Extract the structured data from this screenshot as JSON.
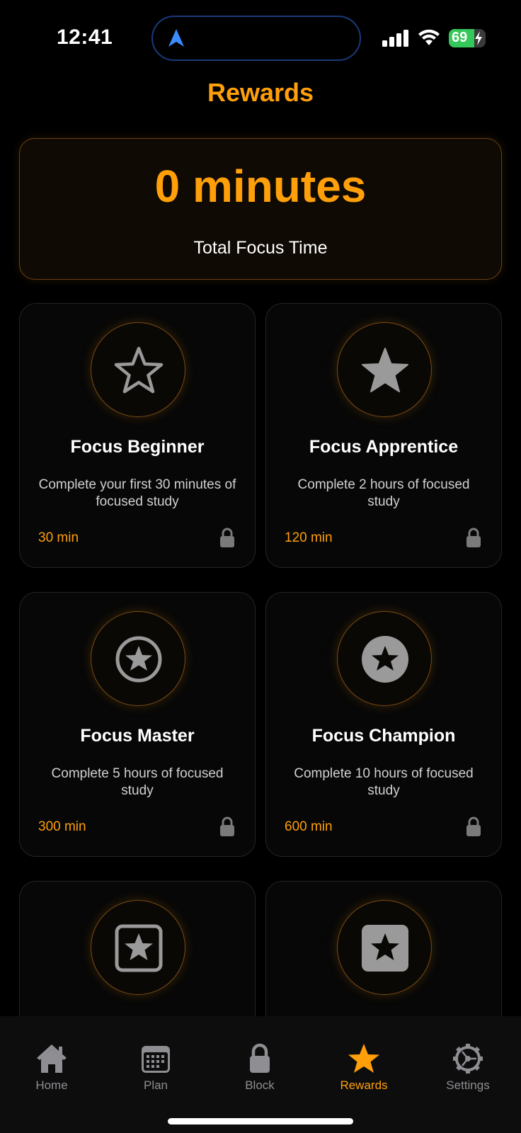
{
  "status_bar": {
    "time": "12:41",
    "battery_percent": "69",
    "battery_level": 0.69,
    "battery_color": "#34c759"
  },
  "page": {
    "title": "Rewards",
    "accent_color": "#ff9f0a"
  },
  "summary": {
    "value": "0 minutes",
    "label": "Total Focus Time"
  },
  "achievements": [
    {
      "title": "Focus Beginner",
      "description": "Complete your first 30 minutes of focused study",
      "requirement": "30 min",
      "icon": "star-outline-icon",
      "locked": true
    },
    {
      "title": "Focus Apprentice",
      "description": "Complete 2 hours of focused study",
      "requirement": "120 min",
      "icon": "star-filled-icon",
      "locked": true
    },
    {
      "title": "Focus Master",
      "description": "Complete 5 hours of focused study",
      "requirement": "300 min",
      "icon": "star-circle-outline-icon",
      "locked": true
    },
    {
      "title": "Focus Champion",
      "description": "Complete 10 hours of focused study",
      "requirement": "600 min",
      "icon": "star-circle-filled-icon",
      "locked": true
    },
    {
      "title": "",
      "description": "",
      "requirement": "",
      "icon": "star-square-outline-icon",
      "locked": true
    },
    {
      "title": "",
      "description": "",
      "requirement": "",
      "icon": "star-square-filled-icon",
      "locked": true
    }
  ],
  "tabs": [
    {
      "label": "Home",
      "icon": "house-icon",
      "active": false
    },
    {
      "label": "Plan",
      "icon": "calendar-icon",
      "active": false
    },
    {
      "label": "Block",
      "icon": "lock-icon",
      "active": false
    },
    {
      "label": "Rewards",
      "icon": "star-icon",
      "active": true
    },
    {
      "label": "Settings",
      "icon": "gear-icon",
      "active": false
    }
  ]
}
